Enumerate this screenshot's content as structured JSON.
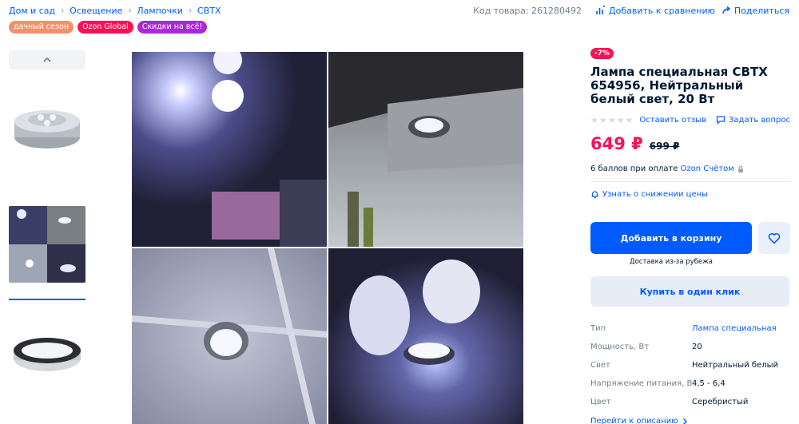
{
  "breadcrumbs": [
    "Дом и сад",
    "Освещение",
    "Лампочки",
    "CBTX"
  ],
  "meta": {
    "sku": "Код товара: 261280492",
    "compare_label": "Добавить к сравнению",
    "share_label": "Поделиться"
  },
  "tags": [
    {
      "label": "дачный сезон",
      "color": "#f1916a"
    },
    {
      "label": "Ozon Global",
      "color": "#f91155"
    },
    {
      "label": "Скидки на всё!",
      "color": "#a829d6"
    }
  ],
  "product": {
    "discount": "-7%",
    "title": "Лампа специальная CBTX 654956, Нейтральный белый свет, 20 Вт",
    "review_label": "Оставить отзыв",
    "ask_label": "Задать вопрос",
    "price": "649 ₽",
    "old_price": "699 ₽",
    "bonus_text": "6 баллов при оплате",
    "bonus_link": "Ozon Счётом",
    "notify_label": "Узнать о снижении цены",
    "cart_label": "Добавить в корзину",
    "delivery_label": "Доставка из-за рубежа",
    "oneclick_label": "Купить в один клик",
    "to_description": "Перейти к описанию"
  },
  "specs": [
    {
      "key": "Тип",
      "value": "Лампа специальная",
      "link": true
    },
    {
      "key": "Мощность, Вт",
      "value": "20",
      "link": false
    },
    {
      "key": "Свет",
      "value": "Нейтральный белый",
      "link": false
    },
    {
      "key": "Напряжение питания, В",
      "value": "4,5 - 6,4",
      "link": false
    },
    {
      "key": "Цвет",
      "value": "Серебристый",
      "link": false
    }
  ],
  "colors": {
    "accent": "#005bff",
    "price": "#f91155"
  }
}
